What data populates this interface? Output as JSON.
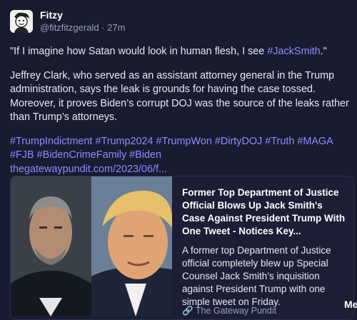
{
  "post": {
    "display_name": "Fitzy",
    "handle": "@fitzfitzgerald",
    "separator": " · ",
    "time_ago": "27m",
    "quote_prefix": "\"If I imagine how Satan would look in human flesh, I see ",
    "quote_tag": "#JackSmith",
    "quote_suffix": ".\"",
    "body": "Jeffrey Clark, who served as an assistant attorney general in the Trump administration, says the leak is grounds for having the case tossed. Moreover, it proves Biden’s corrupt DOJ was the source of the leaks rather than Trump’s attorneys.",
    "hashtags": [
      "#TrumpIndictment",
      "#Trump2024",
      "#TrumpWon",
      "#DirtyDOJ",
      "#Truth",
      "#MAGA",
      "#FJB",
      "#BidenCrimeFamily",
      "#Biden"
    ],
    "link_text": "thegatewaypundit.com/2023/06/f..."
  },
  "card": {
    "title": "Former Top Department of Justice Official Blows Up Jack Smith's Case Against President Trump With One Tweet - Notices Key...",
    "description": "A former top Department of Justice official completely blew up Special Counsel Jack Smith’s inquisition against President Trump with one simple tweet on Friday.",
    "source": "The Gateway Pundit"
  },
  "overlay": {
    "label": "Me"
  },
  "icons": {
    "avatar": "cartoon-avatar-icon",
    "source": "link-icon"
  },
  "colors": {
    "background": "#191b30",
    "accent": "#8c8dff",
    "muted": "#9a9cc0"
  }
}
